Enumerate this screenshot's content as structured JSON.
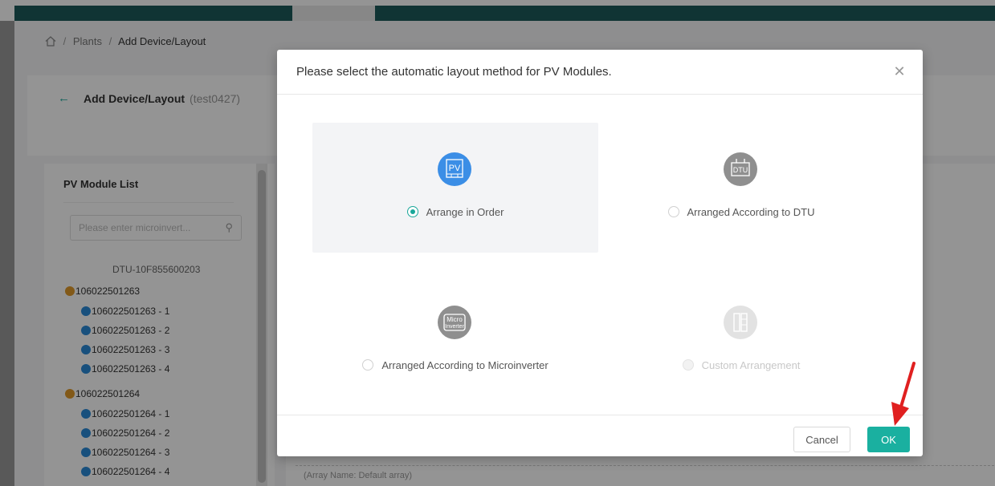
{
  "breadcrumb": {
    "plants": "Plants",
    "current": "Add Device/Layout"
  },
  "header": {
    "title": "Add Device/Layout",
    "subtitle": "(test0427)"
  },
  "pv_list": {
    "title": "PV Module List",
    "search_placeholder": "Please enter microinvert...",
    "dtu": "DTU-10F855600203",
    "items": [
      "106022501263",
      "106022501263 - 1",
      "106022501263 - 2",
      "106022501263 - 3",
      "106022501263 - 4",
      "106022501264",
      "106022501264 - 1",
      "106022501264 - 2",
      "106022501264 - 3",
      "106022501264 - 4"
    ]
  },
  "array_name": "(Array Name: Default array)",
  "modal": {
    "title": "Please select the automatic layout method for PV Modules.",
    "options": [
      {
        "label": "Arrange in Order",
        "icon": "PV",
        "selected": true,
        "disabled": false
      },
      {
        "label": "Arranged According to DTU",
        "icon": "DTU",
        "selected": false,
        "disabled": false
      },
      {
        "label": "Arranged According to Microinverter",
        "icon": "Micro Inverter",
        "selected": false,
        "disabled": false
      },
      {
        "label": "Custom Arrangement",
        "icon": "",
        "selected": false,
        "disabled": true
      }
    ],
    "cancel_label": "Cancel",
    "ok_label": "OK"
  },
  "colors": {
    "accent": "#1ab0a0",
    "selected_icon": "#3b8ee6",
    "icon_gray": "#8f8f8f",
    "annotation_arrow": "#e02020"
  }
}
